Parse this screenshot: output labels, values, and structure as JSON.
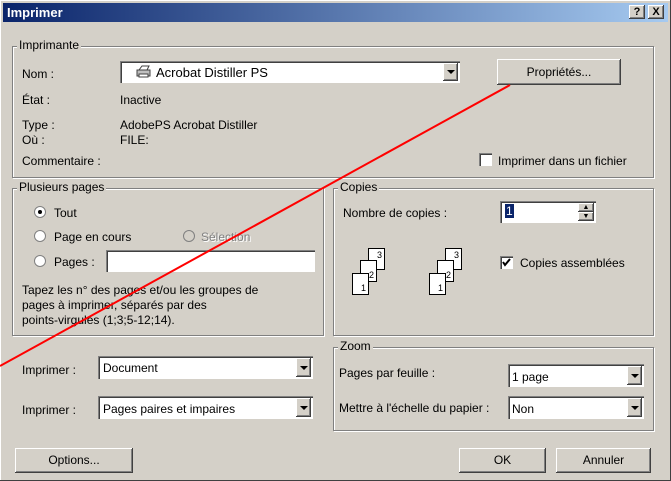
{
  "window": {
    "title": "Imprimer",
    "help_label": "?",
    "close_label": "X"
  },
  "printer": {
    "legend": "Imprimante",
    "name_label": "Nom :",
    "name_value": "Acrobat Distiller PS",
    "properties_label": "Propriétés...",
    "state_label": "État :",
    "state_value": "Inactive",
    "type_label": "Type :",
    "type_value": "AdobePS Acrobat Distiller",
    "where_label": "Où :",
    "where_value": "FILE:",
    "comment_label": "Commentaire :",
    "print_to_file_label": "Imprimer dans un fichier",
    "print_to_file_checked": false
  },
  "pages": {
    "legend": "Plusieurs pages",
    "all_label": "Tout",
    "current_label": "Page en cours",
    "selection_label": "Sélection",
    "pages_label": "Pages :",
    "pages_value": "",
    "selected": "all",
    "help_line1": "Tapez les n° des pages et/ou les groupes de",
    "help_line2": "pages à imprimer, séparés par des",
    "help_line3": "points-virgules (1;3;5-12;14)."
  },
  "copies": {
    "legend": "Copies",
    "count_label": "Nombre de copies :",
    "count_value": "1",
    "collate_label": "Copies assemblées",
    "collate_checked": true,
    "stack_labels": [
      "1",
      "2",
      "3"
    ]
  },
  "print_what": {
    "label": "Imprimer :",
    "value": "Document"
  },
  "print_range": {
    "label": "Imprimer :",
    "value": "Pages paires et impaires"
  },
  "zoom": {
    "legend": "Zoom",
    "per_sheet_label": "Pages par feuille :",
    "per_sheet_value": "1 page",
    "scale_label": "Mettre à l'échelle du papier :",
    "scale_value": "Non"
  },
  "buttons": {
    "options": "Options...",
    "ok": "OK",
    "cancel": "Annuler"
  },
  "colors": {
    "title_start": "#0a246a",
    "title_end": "#a6caf0",
    "face": "#d4d0c8",
    "annotation_line": "#ff0000"
  }
}
